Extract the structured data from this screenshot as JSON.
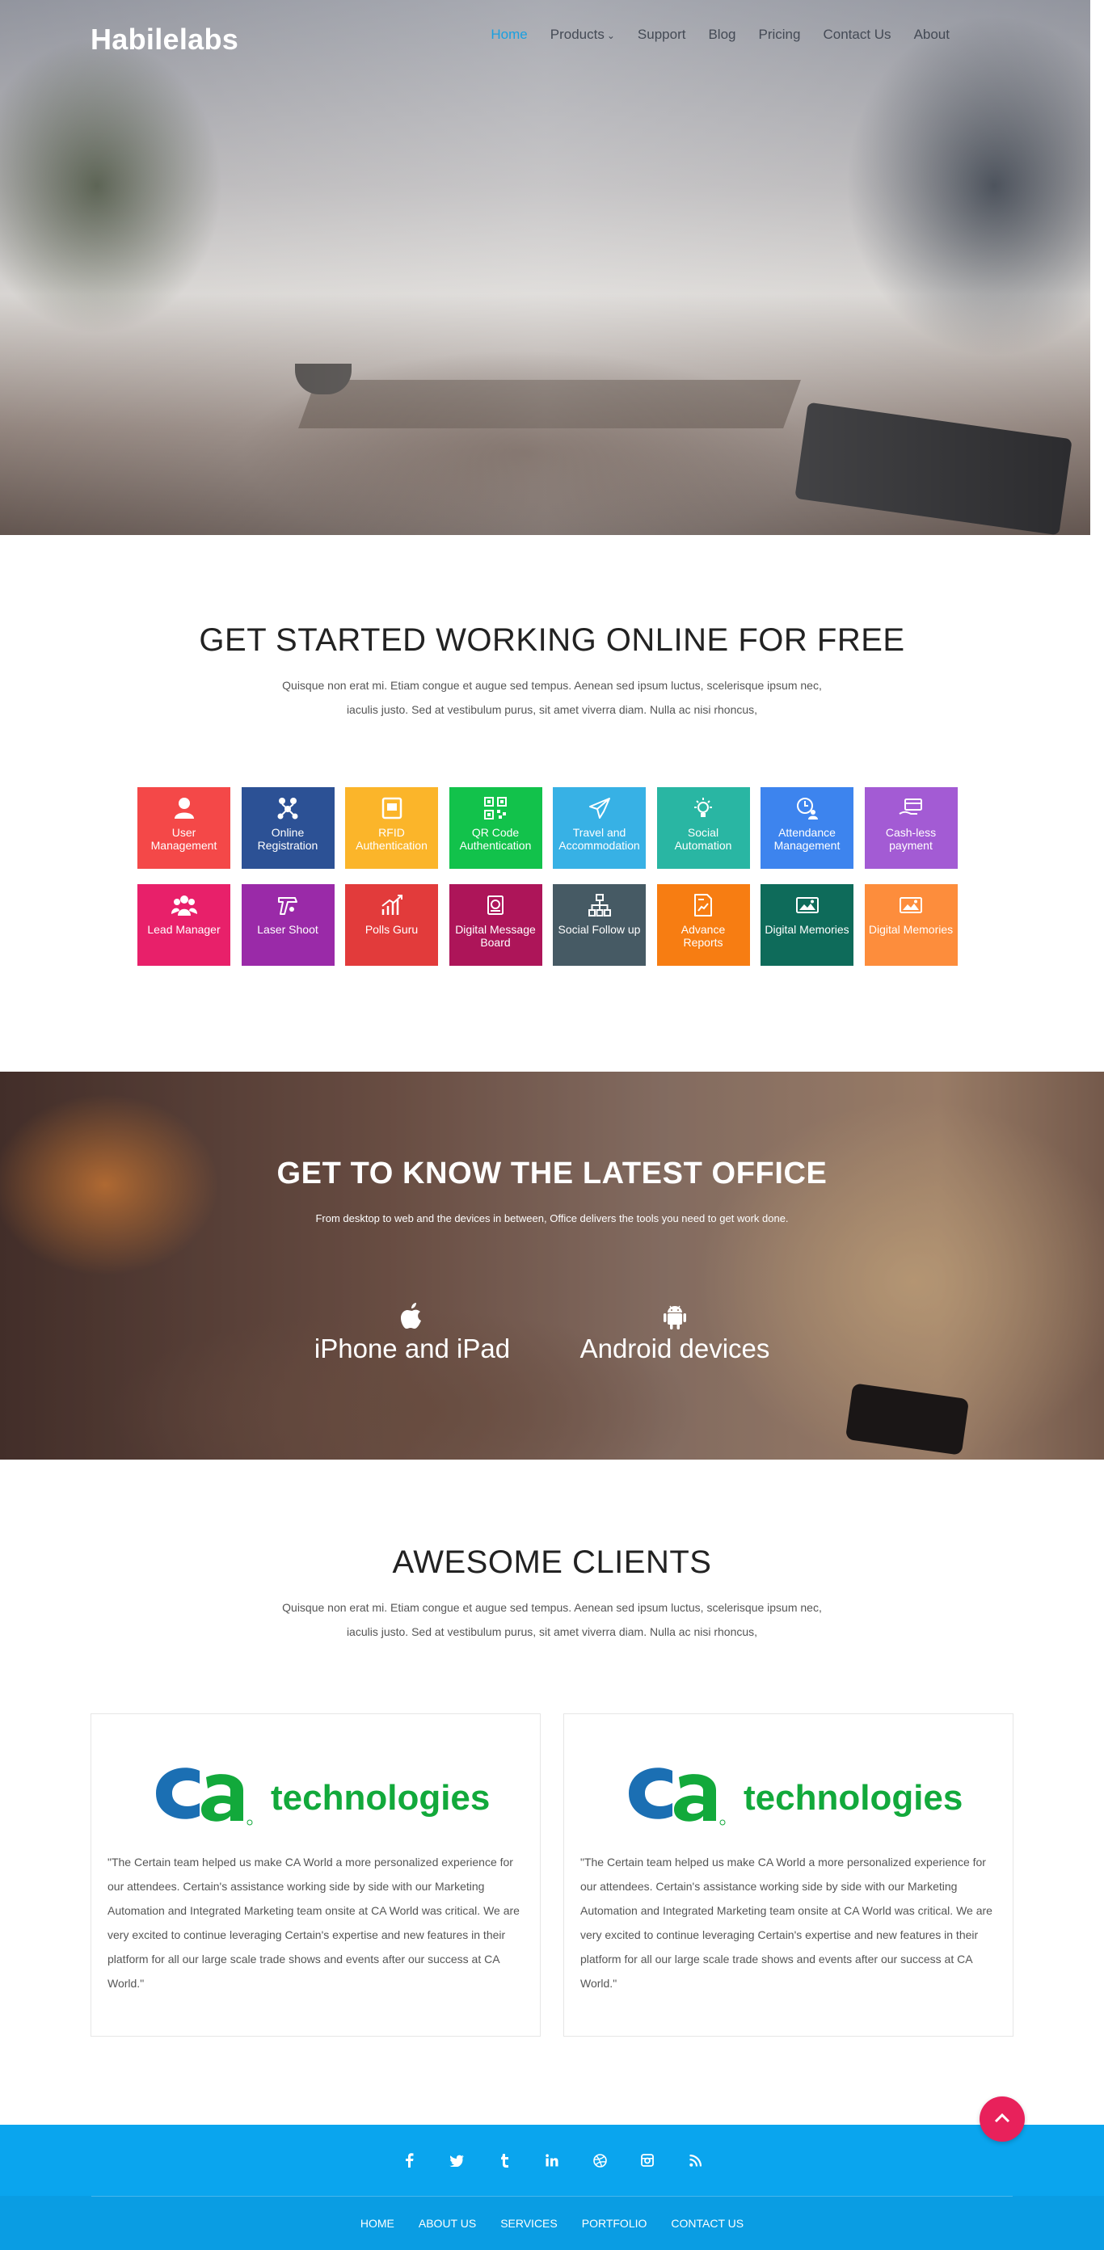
{
  "brand": {
    "logo_text": "Habilelabs"
  },
  "nav": {
    "items": [
      {
        "label": "Home",
        "active": true
      },
      {
        "label": "Products",
        "dropdown": true
      },
      {
        "label": "Support"
      },
      {
        "label": "Blog"
      },
      {
        "label": "Pricing"
      },
      {
        "label": "Contact Us"
      },
      {
        "label": "About"
      }
    ]
  },
  "features": {
    "title": "GET STARTED WORKING ONLINE FOR FREE",
    "description": "Quisque non erat mi. Etiam congue et augue sed tempus. Aenean sed ipsum luctus, scelerisque ipsum nec, iaculis justo. Sed at vestibulum purus, sit amet viverra diam. Nulla ac nisi rhoncus,",
    "tiles": [
      {
        "label": "User Management",
        "color": "#f44848",
        "icon": "user-icon"
      },
      {
        "label": "Online Registration",
        "color": "#2c5195",
        "icon": "network-users-icon"
      },
      {
        "label": "RFID Authentication",
        "color": "#fbb52a",
        "icon": "rfid-card-icon"
      },
      {
        "label": "QR Code Authentication",
        "color": "#12c24b",
        "icon": "qr-code-icon"
      },
      {
        "label": "Travel and Accommodation",
        "color": "#37b1e5",
        "icon": "airplane-icon"
      },
      {
        "label": "Social Automation",
        "color": "#29b6a3",
        "icon": "lightbulb-icon"
      },
      {
        "label": "Attendance Management",
        "color": "#3d84ee",
        "icon": "clock-user-icon"
      },
      {
        "label": "Cash-less payment",
        "color": "#a35bd4",
        "icon": "card-hand-icon"
      },
      {
        "label": "Lead Manager",
        "color": "#e8206a",
        "icon": "group-icon"
      },
      {
        "label": "Laser Shoot",
        "color": "#9a2aa8",
        "icon": "laser-gun-icon"
      },
      {
        "label": "Polls Guru",
        "color": "#e23b3b",
        "icon": "chart-growth-icon"
      },
      {
        "label": "Digital Message Board",
        "color": "#ad1559",
        "icon": "message-board-icon"
      },
      {
        "label": "Social Follow up",
        "color": "#465a64",
        "icon": "hierarchy-icon"
      },
      {
        "label": "Advance Reports",
        "color": "#f77d12",
        "icon": "report-icon"
      },
      {
        "label": "Digital Memories",
        "color": "#0e6b5a",
        "icon": "photo-icon"
      },
      {
        "label": "Digital Memories",
        "color": "#fd8d3c",
        "icon": "photo-icon"
      }
    ]
  },
  "office": {
    "title": "GET TO KNOW THE LATEST OFFICE",
    "subtitle": "From desktop to web and the devices in between, Office delivers the tools you need to get work done.",
    "devices": [
      {
        "label": "iPhone and iPad",
        "icon": "apple-icon"
      },
      {
        "label": "Android devices",
        "icon": "android-icon"
      }
    ]
  },
  "clients": {
    "title": "AWESOME CLIENTS",
    "description": "Quisque non erat mi. Etiam congue et augue sed tempus. Aenean sed ipsum luctus, scelerisque ipsum nec, iaculis justo. Sed at vestibulum purus, sit amet viverra diam. Nulla ac nisi rhoncus,",
    "cards": [
      {
        "logo_mark": "ca",
        "logo_word": "technologies",
        "quote": "\"The Certain team helped us make CA World a more personalized experience for our attendees. Certain's assistance working side by side with our Marketing Automation and Integrated Marketing team onsite at CA World was critical. We are very excited to continue leveraging Certain's expertise and new features in their platform for all our large scale trade shows and events after our success at CA World.\""
      },
      {
        "logo_mark": "ca",
        "logo_word": "technologies",
        "quote": "\"The Certain team helped us make CA World a more personalized experience for our attendees. Certain's assistance working side by side with our Marketing Automation and Integrated Marketing team onsite at CA World was critical. We are very excited to continue leveraging Certain's expertise and new features in their platform for all our large scale trade shows and events after our success at CA World.\""
      }
    ]
  },
  "footer": {
    "social": [
      "facebook-icon",
      "twitter-icon",
      "tumblr-icon",
      "linkedin-icon",
      "dribbble-icon",
      "instagram-icon",
      "rss-icon"
    ],
    "links": [
      "HOME",
      "ABOUT US",
      "SERVICES",
      "PORTFOLIO",
      "CONTACT US"
    ]
  },
  "colors": {
    "accent": "#1aa0e0",
    "footer_top": "#0aa5ee",
    "footer_bottom": "#0a9de3",
    "scroll_top_button": "#e8215b"
  }
}
